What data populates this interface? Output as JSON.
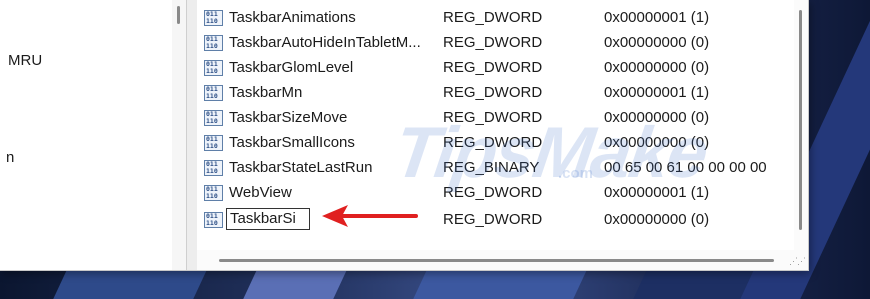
{
  "tree": {
    "items": [
      {
        "label": "MRU"
      },
      {
        "label": "n"
      }
    ]
  },
  "values": [
    {
      "name": "TaskbarAnimations",
      "type": "REG_DWORD",
      "data": "0x00000001 (1)"
    },
    {
      "name": "TaskbarAutoHideInTabletM...",
      "type": "REG_DWORD",
      "data": "0x00000000 (0)"
    },
    {
      "name": "TaskbarGlomLevel",
      "type": "REG_DWORD",
      "data": "0x00000000 (0)"
    },
    {
      "name": "TaskbarMn",
      "type": "REG_DWORD",
      "data": "0x00000001 (1)"
    },
    {
      "name": "TaskbarSizeMove",
      "type": "REG_DWORD",
      "data": "0x00000000 (0)"
    },
    {
      "name": "TaskbarSmallIcons",
      "type": "REG_DWORD",
      "data": "0x00000000 (0)"
    },
    {
      "name": "TaskbarStateLastRun",
      "type": "REG_BINARY",
      "data": "00 65 00 61 00 00 00 00"
    },
    {
      "name": "WebView",
      "type": "REG_DWORD",
      "data": "0x00000001 (1)"
    }
  ],
  "editing": {
    "name": "TaskbarSi",
    "type": "REG_DWORD",
    "data": "0x00000000 (0)"
  },
  "icons": {
    "value": "reg-binary-value-icon"
  },
  "watermark": {
    "brand": "TipsMake",
    "suffix": ".com"
  },
  "colors": {
    "arrow": "#e02020",
    "selection_border": "#333333"
  }
}
